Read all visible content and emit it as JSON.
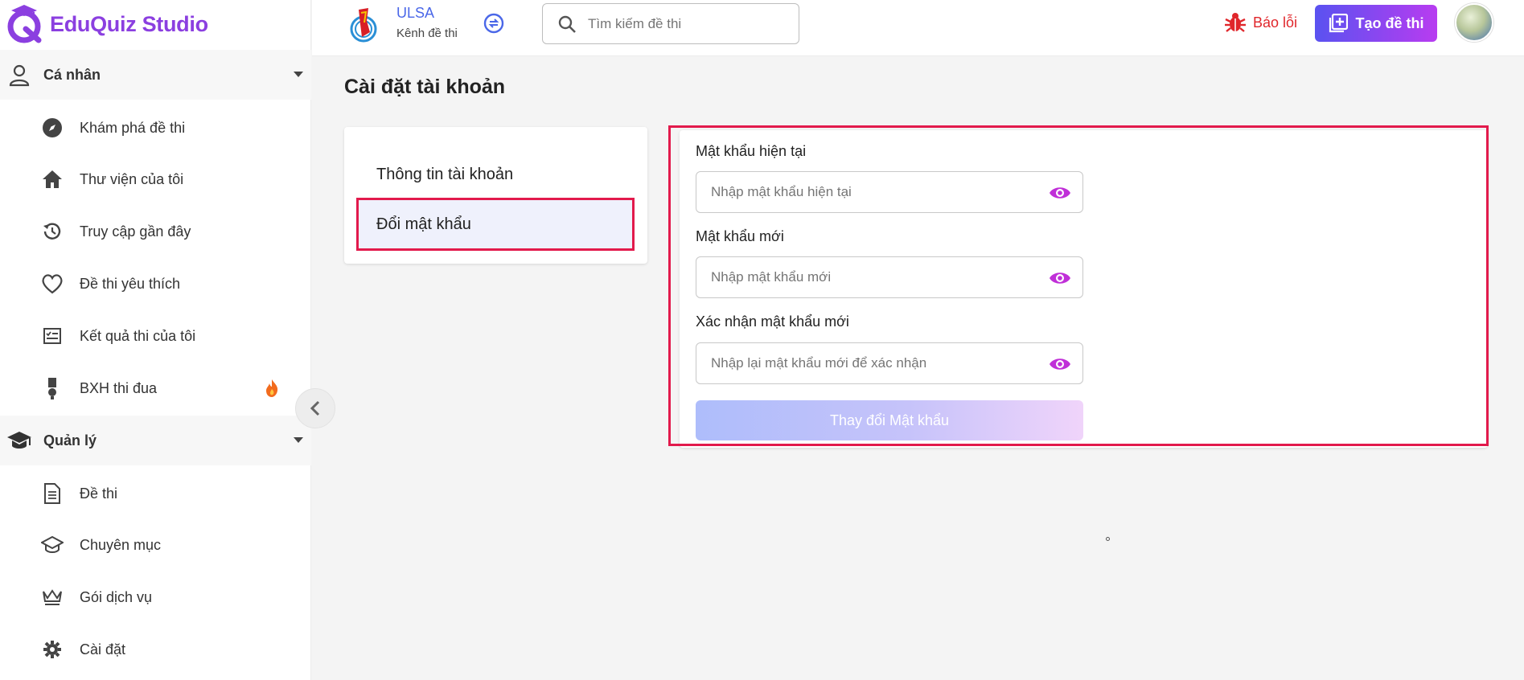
{
  "app": {
    "name": "EduQuiz Studio",
    "brand_color": "#8b3fe0",
    "highlight_color": "#e21a4c"
  },
  "sidebar": {
    "personal": {
      "label": "Cá nhân",
      "icon": "user-icon",
      "items": [
        {
          "label": "Khám phá đề thi",
          "icon": "compass-icon"
        },
        {
          "label": "Thư viện của tôi",
          "icon": "home-icon"
        },
        {
          "label": "Truy cập gần đây",
          "icon": "history-icon"
        },
        {
          "label": "Đề thi yêu thích",
          "icon": "heart-icon"
        },
        {
          "label": "Kết quả thi của tôi",
          "icon": "checklist-icon"
        },
        {
          "label": "BXH thi đua",
          "icon": "medal-icon",
          "badge_icon": "fire-icon"
        }
      ]
    },
    "manage": {
      "label": "Quản lý",
      "icon": "graduation-cap-icon",
      "items": [
        {
          "label": "Đề thi",
          "icon": "document-icon"
        },
        {
          "label": "Chuyên mục",
          "icon": "school-icon"
        },
        {
          "label": "Gói dịch vụ",
          "icon": "crown-icon"
        },
        {
          "label": "Cài đặt",
          "icon": "gear-icon"
        }
      ]
    }
  },
  "header": {
    "org_name": "ULSA",
    "org_subtitle": "Kênh đề thi",
    "search_placeholder": "Tìm kiếm đề thi",
    "report_label": "Báo lỗi",
    "create_label": "Tạo đề thi"
  },
  "page": {
    "title": "Cài đặt tài khoản",
    "menu": [
      {
        "label": "Thông tin tài khoản",
        "active": false
      },
      {
        "label": "Đổi mật khẩu",
        "active": true
      }
    ],
    "form": {
      "current_label": "Mật khẩu hiện tại",
      "current_placeholder": "Nhập mật khẩu hiện tại",
      "new_label": "Mật khẩu mới",
      "new_placeholder": "Nhập mật khẩu mới",
      "confirm_label": "Xác nhận mật khẩu mới",
      "confirm_placeholder": "Nhập lại mật khẩu mới để xác nhận",
      "submit_label": "Thay đổi Mật khẩu"
    }
  }
}
